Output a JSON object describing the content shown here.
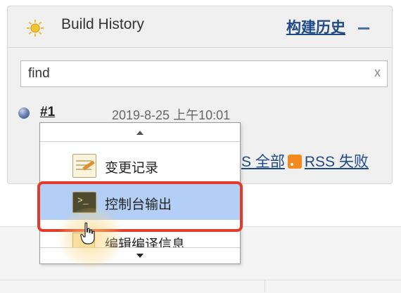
{
  "build_history": {
    "title": "Build History",
    "title_cn": "构建历史",
    "search": {
      "value": "find",
      "clear": "x"
    },
    "builds": [
      {
        "number": "#1",
        "time": "2019-8-25 上午10:01"
      }
    ],
    "rss": {
      "all_suffix": "S 全部",
      "failed": "RSS 失败"
    }
  },
  "context_menu": {
    "items": [
      {
        "label": "变更记录",
        "icon": "notepad-icon"
      },
      {
        "label": "控制台输出",
        "icon": "console-icon",
        "highlighted": true
      },
      {
        "label": "编辑编译信息",
        "icon": "edit-icon"
      }
    ]
  },
  "colors": {
    "link": "#204a87",
    "highlight_border": "#e33b2b",
    "selected_item": "#b3cff5"
  }
}
